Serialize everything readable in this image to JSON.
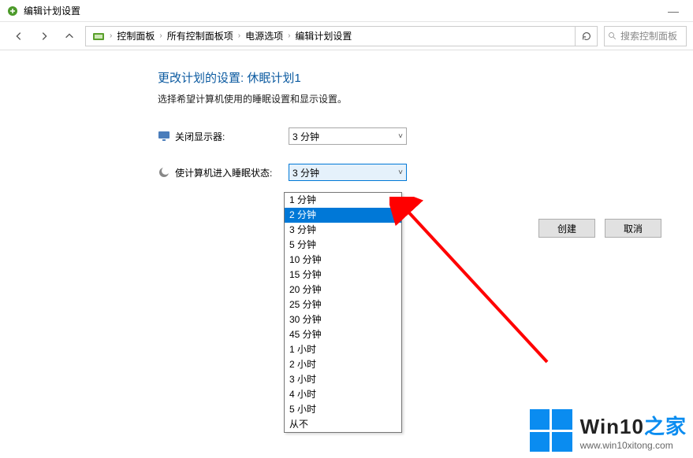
{
  "window": {
    "title": "编辑计划设置"
  },
  "breadcrumb": {
    "items": [
      "控制面板",
      "所有控制面板项",
      "电源选项",
      "编辑计划设置"
    ]
  },
  "search": {
    "placeholder": "搜索控制面板"
  },
  "page": {
    "title": "更改计划的设置: 休眠计划1",
    "description": "选择希望计算机使用的睡眠设置和显示设置。"
  },
  "settings": {
    "display_off": {
      "label": "关闭显示器:",
      "value": "3 分钟"
    },
    "sleep": {
      "label": "使计算机进入睡眠状态:",
      "value": "3 分钟"
    }
  },
  "dropdown": {
    "options": [
      "1 分钟",
      "2 分钟",
      "3 分钟",
      "5 分钟",
      "10 分钟",
      "15 分钟",
      "20 分钟",
      "25 分钟",
      "30 分钟",
      "45 分钟",
      "1 小时",
      "2 小时",
      "3 小时",
      "4 小时",
      "5 小时",
      "从不"
    ],
    "selected_index": 1
  },
  "buttons": {
    "create": "创建",
    "cancel": "取消"
  },
  "watermark": {
    "brand": "Win10",
    "suffix": "之家",
    "url": "www.win10xitong.com"
  }
}
